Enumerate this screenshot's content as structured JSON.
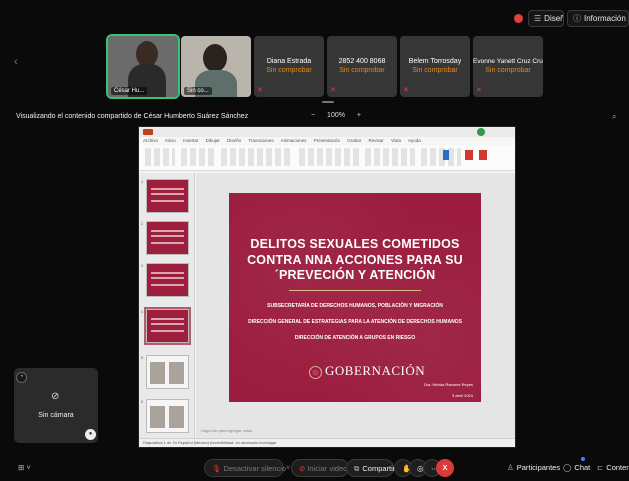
{
  "top_bar": {
    "design_label": "Diseño",
    "meeting_info_label": "Información de Meeting"
  },
  "participants": [
    {
      "label": "César Hu..."
    },
    {
      "label": "Sin co..."
    },
    {
      "name": "Diana Estrada",
      "status": "Sin comprobar"
    },
    {
      "name": "2852 400 8068",
      "status": "Sin comprobar"
    },
    {
      "name": "Belem Torrosday",
      "status": "Sin comprobar"
    },
    {
      "name": "Evonne Yanett Cruz Cruz",
      "status": "Sin comprobar"
    }
  ],
  "share": {
    "viewing_label": "Visualizando el contenido compartido de César Humberto Suárez Sánchez",
    "zoom_minus": "−",
    "zoom_level": "100%",
    "zoom_plus": "+"
  },
  "slide": {
    "title": "DELITOS SEXUALES COMETIDOS CONTRA NNA ACCIONES PARA SU ´PREVECIÓN Y ATENCIÓN",
    "line1": "SUBSECRETARÍA DE DERECHOS HUMANOS, POBLACIÓN Y MIGRACIÓN",
    "line2": "DIRECCIÓN GENERAL DE ESTRATEGIAS PARA LA ATENCIÓN DE DERECHOS HUMANOS",
    "line3": "DIRECCIÓN DE ATENCIÓN A GRUPOS EN RIESGO",
    "logo_text": "GOBERNACIÓN",
    "author": "Dra. Nérida Ramírez Reyes",
    "date": "3 abril 2024"
  },
  "app_window": {
    "menu": [
      "Archivo",
      "Inicio",
      "Insertar",
      "Dibujar",
      "Diseño",
      "Transiciones",
      "Animaciones",
      "Presentación",
      "Grabar",
      "Revisar",
      "Vista",
      "Ayuda"
    ],
    "notes_placeholder": "Haga clic para agregar notas",
    "status_text": "Diapositiva 1 de 24   Español (México)   Accesibilidad: es necesario investigar"
  },
  "self_view": {
    "label": "Sin cámara"
  },
  "toolbar": {
    "unmute": "Desactivar silencio",
    "start_video": "Iniciar video",
    "share": "Compartir",
    "end": "X",
    "participants": "Participantes",
    "chat": "Chat",
    "content": "Contenido"
  }
}
